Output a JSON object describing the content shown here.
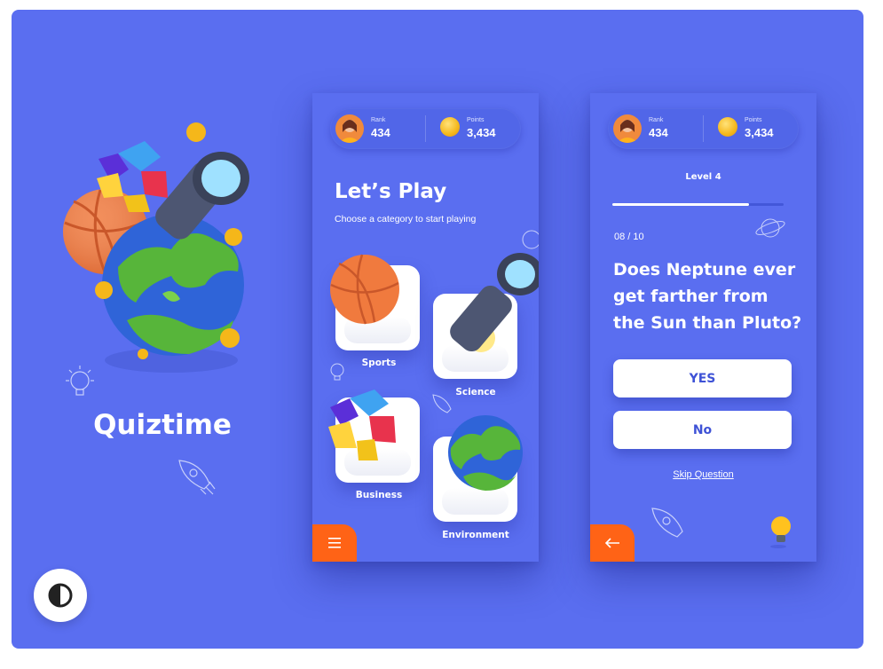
{
  "brand": {
    "title": "Quiztime"
  },
  "colors": {
    "background": "#5a6ef0",
    "accent_orange": "#ff6316",
    "white": "#ffffff",
    "button_text": "#3e52d6"
  },
  "icons": {
    "theme_toggle": "contrast-icon",
    "menu": "hamburger-menu-icon",
    "back": "arrow-left-icon",
    "hint": "lightbulb-icon"
  },
  "stats": {
    "rank_label": "Rank",
    "rank_value": "434",
    "points_label": "Points",
    "points_value": "3,434"
  },
  "categories_screen": {
    "title": "Let’s Play",
    "subtitle": "Choose a category to start playing",
    "categories": [
      {
        "label": "Sports",
        "icon": "basketball-icon"
      },
      {
        "label": "Science",
        "icon": "telescope-icon"
      },
      {
        "label": "Business",
        "icon": "pie-chart-icon"
      },
      {
        "label": "Environment",
        "icon": "earth-globe-icon"
      }
    ]
  },
  "quiz_screen": {
    "level": "Level 4",
    "progress": 0.8,
    "counter": "08 / 10",
    "question": "Does Neptune ever get farther from the Sun than Pluto?",
    "answers": [
      "YES",
      "No"
    ],
    "skip": "Skip Question"
  }
}
